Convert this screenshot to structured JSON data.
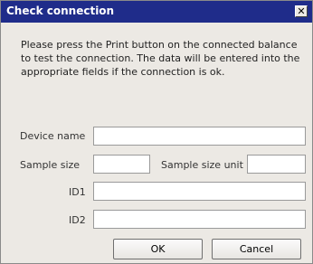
{
  "window": {
    "title": "Check connection",
    "close_glyph": "✕"
  },
  "message": "Please press the Print button on the connected balance to test the connection. The data will be entered into the appropriate fields if the connection is ok.",
  "fields": {
    "device_name": {
      "label": "Device name",
      "value": ""
    },
    "sample_size": {
      "label": "Sample size",
      "value": ""
    },
    "sample_size_unit": {
      "label": "Sample size unit",
      "value": ""
    },
    "id1": {
      "label": "ID1",
      "value": ""
    },
    "id2": {
      "label": "ID2",
      "value": ""
    }
  },
  "buttons": {
    "ok": "OK",
    "cancel": "Cancel"
  },
  "icons": {
    "close": "close-icon"
  },
  "colors": {
    "titlebar": "#1f2c8a",
    "dialog_bg": "#ece9e4"
  }
}
